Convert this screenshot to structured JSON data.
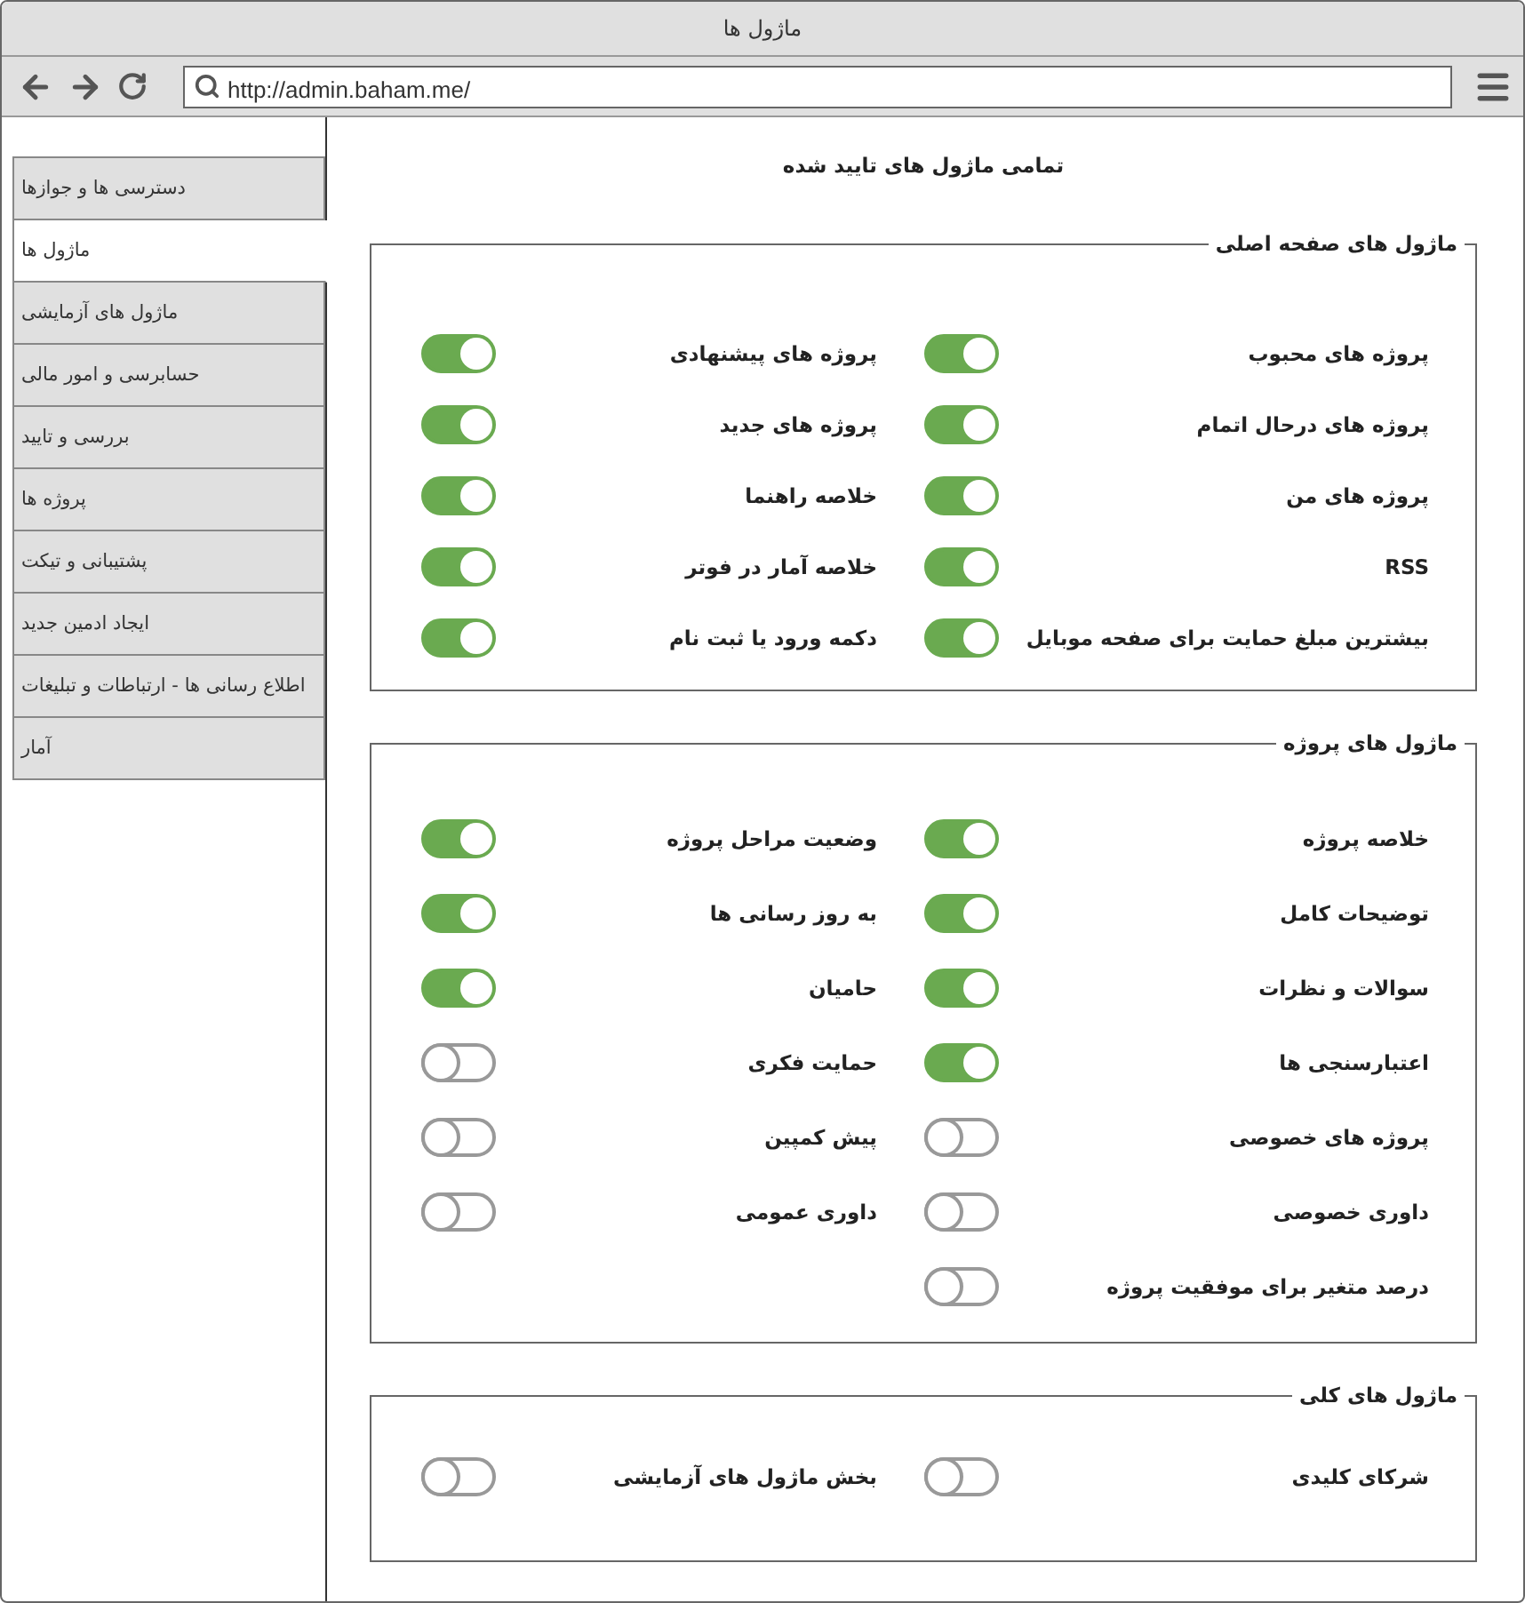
{
  "window": {
    "title": "ماژول ها"
  },
  "address_bar": {
    "value": "http://admin.baham.me/"
  },
  "sidebar": {
    "items": [
      {
        "label": "دسترسی ها و جوازها",
        "selected": false
      },
      {
        "label": "ماژول ها",
        "selected": true
      },
      {
        "label": "ماژول های آزمایشی",
        "selected": false
      },
      {
        "label": "حسابرسی و امور مالی",
        "selected": false
      },
      {
        "label": "بررسی و تایید",
        "selected": false
      },
      {
        "label": "پروژه ها",
        "selected": false
      },
      {
        "label": "پشتیبانی و تیکت",
        "selected": false
      },
      {
        "label": "ایجاد ادمین جدید",
        "selected": false
      },
      {
        "label": "اطلاع رسانی ها - ارتباطات و تبلیغات",
        "selected": false
      },
      {
        "label": "آمار",
        "selected": false
      }
    ]
  },
  "heading": "تمامی ماژول های تایید شده",
  "sections": [
    {
      "title": "ماژول های صفحه اصلی",
      "items": [
        {
          "label": "پروژه های محبوب",
          "on": true
        },
        {
          "label": "پروژه های پیشنهادی",
          "on": true
        },
        {
          "label": "پروژه های درحال اتمام",
          "on": true
        },
        {
          "label": "پروژه های جدید",
          "on": true
        },
        {
          "label": "پروژه های من",
          "on": true
        },
        {
          "label": "خلاصه راهنما",
          "on": true
        },
        {
          "label": "RSS",
          "on": true
        },
        {
          "label": "خلاصه آمار در فوتر",
          "on": true
        },
        {
          "label": "بیشترین مبلغ حمایت برای صفحه موبایل",
          "on": true
        },
        {
          "label": "دکمه ورود یا ثبت نام",
          "on": true
        }
      ]
    },
    {
      "title": "ماژول های پروژه",
      "items": [
        {
          "label": "خلاصه پروژه",
          "on": true
        },
        {
          "label": "وضعیت مراحل پروژه",
          "on": true
        },
        {
          "label": "توضیحات کامل",
          "on": true
        },
        {
          "label": "به روز رسانی ها",
          "on": true
        },
        {
          "label": "سوالات و نظرات",
          "on": true
        },
        {
          "label": "حامیان",
          "on": true
        },
        {
          "label": "اعتبارسنجی ها",
          "on": true
        },
        {
          "label": "حمایت فکری",
          "on": false
        },
        {
          "label": "پروژه های خصوصی",
          "on": false
        },
        {
          "label": "پیش کمپین",
          "on": false
        },
        {
          "label": "داوری خصوصی",
          "on": false
        },
        {
          "label": "داوری عمومی",
          "on": false
        },
        {
          "label": "درصد متغیر برای موفقیت پروژه",
          "on": false
        }
      ]
    },
    {
      "title": "ماژول های کلی",
      "items": [
        {
          "label": "شرکای کلیدی",
          "on": false
        },
        {
          "label": "بخش ماژول های آزمایشی",
          "on": false
        }
      ]
    }
  ]
}
